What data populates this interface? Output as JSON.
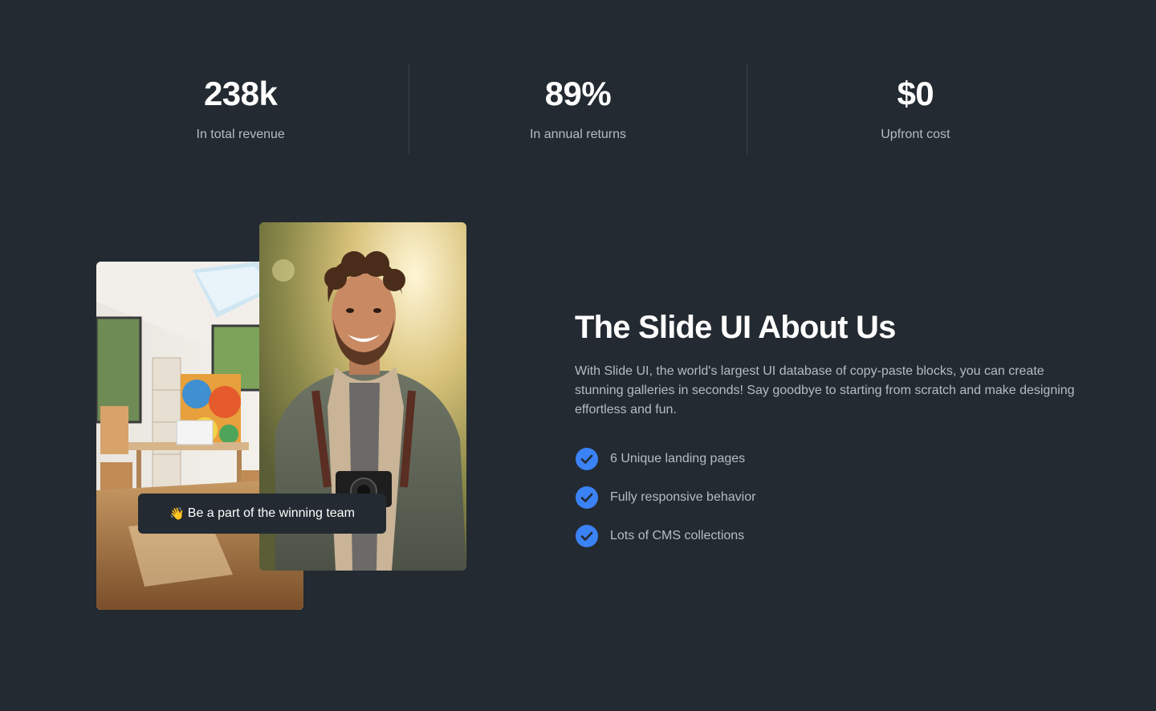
{
  "stats": [
    {
      "value": "238k",
      "label": "In total revenue"
    },
    {
      "value": "89%",
      "label": "In annual returns"
    },
    {
      "value": "$0",
      "label": "Upfront cost"
    }
  ],
  "images": {
    "back": "art-studio-interior-photo",
    "front": "smiling-photographer-portrait-photo"
  },
  "badge": {
    "icon": "waving-hand-icon",
    "emoji": "👋",
    "text": "Be a part of the winning team"
  },
  "about": {
    "title": "The Slide UI About Us",
    "description": "With Slide UI, the world's largest UI database of copy-paste blocks, you can create stunning galleries in seconds! Say goodbye to starting from scratch and make designing effortless and fun.",
    "features": [
      {
        "label": "6 Unique landing pages",
        "icon": "check-circle-icon"
      },
      {
        "label": "Fully responsive behavior",
        "icon": "check-circle-icon"
      },
      {
        "label": "Lots of CMS collections",
        "icon": "check-circle-icon"
      }
    ]
  },
  "colors": {
    "background": "#232a31",
    "text_primary": "#ffffff",
    "text_secondary": "#b5bcc3",
    "divider": "#3b434b",
    "accent": "#3b82f6"
  }
}
